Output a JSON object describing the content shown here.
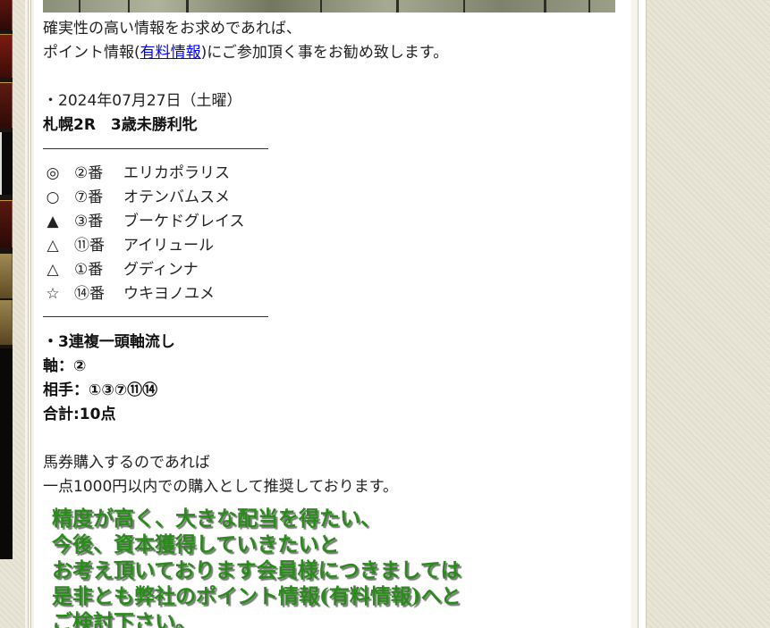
{
  "intro": {
    "line1": "確実性の高い情報をお求めであれば、",
    "line2_before": "ポイント情報(",
    "line2_link": "有料情報",
    "line2_after": ")にご参加頂く事をお勧め致します。"
  },
  "race": {
    "date": "・2024年07月27日（土曜）",
    "name": "札幌2R　3歳未勝利牝"
  },
  "picks": [
    {
      "mark": "◎",
      "number": "②番",
      "horse": "エリカポラリス"
    },
    {
      "mark": "○",
      "number": "⑦番",
      "horse": "オテンバムスメ"
    },
    {
      "mark": "▲",
      "number": "③番",
      "horse": "ブーケドグレイス"
    },
    {
      "mark": "△",
      "number": "⑪番",
      "horse": "アイリュール"
    },
    {
      "mark": "△",
      "number": "①番",
      "horse": "グディンナ"
    },
    {
      "mark": "☆",
      "number": "⑭番",
      "horse": "ウキヨノユメ"
    }
  ],
  "bet": {
    "type": "・3連複一頭軸流し",
    "axis": "軸：②",
    "partners": "相手：①③⑦⑪⑭",
    "total": "合計:10点"
  },
  "purchase": {
    "line1": "馬券購入するのであれば",
    "line2": "一点1000円以内での購入として推奨しております。"
  },
  "promo": {
    "lines": [
      "精度が高く、大きな配当を得たい、",
      "今後、資本獲得していきたいと",
      "お考え頂いております会員様につきましては",
      "是非とも弊社のポイント情報(有料情報)へと",
      "ご検討下さい。"
    ]
  },
  "colors": {
    "link": "#0000ee",
    "promo_text": "#2b8a1c",
    "page_background": "#e8e5d6",
    "left_strip": "#1a1511"
  }
}
